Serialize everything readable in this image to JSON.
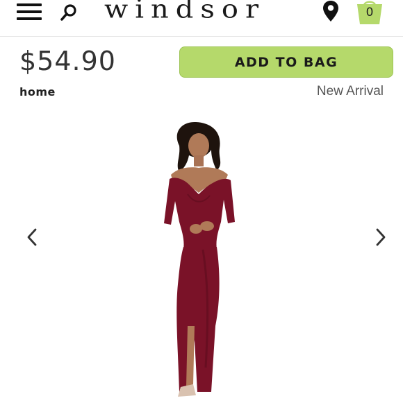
{
  "header": {
    "logo_text": "windsor",
    "bag_count": "0",
    "menu_icon": "hamburger-menu-icon",
    "search_icon": "search-icon",
    "location_icon": "map-pin-icon",
    "bag_icon": "shopping-bag-icon",
    "accent_color": "#b5d96b"
  },
  "product": {
    "price": "$54.90",
    "add_to_bag_label": "ADD TO BAG",
    "breadcrumb": "home",
    "tag": "New Arrival",
    "dress_color": "#7a1228"
  },
  "gallery": {
    "prev_icon": "chevron-left-icon",
    "next_icon": "chevron-right-icon"
  }
}
